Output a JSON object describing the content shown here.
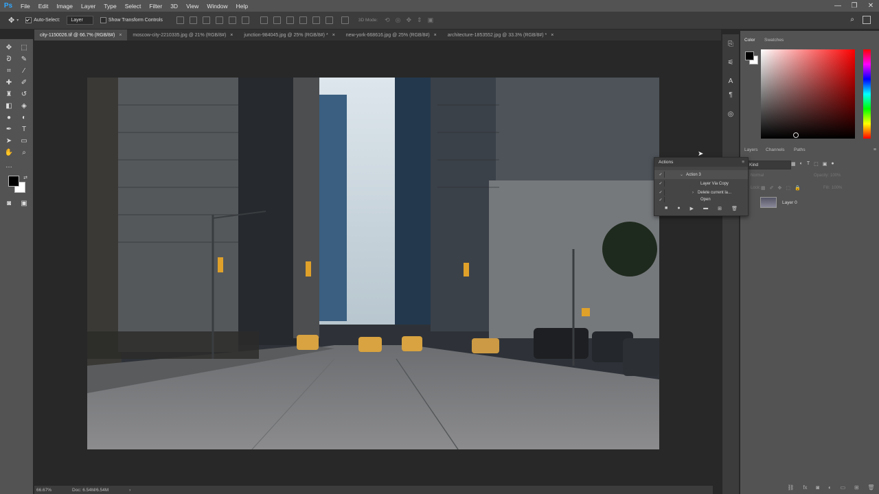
{
  "app": {
    "logo": "Ps"
  },
  "menu": [
    "File",
    "Edit",
    "Image",
    "Layer",
    "Type",
    "Select",
    "Filter",
    "3D",
    "View",
    "Window",
    "Help"
  ],
  "options": {
    "auto_select_label": "Auto-Select:",
    "auto_select_value": "Layer",
    "show_transform_label": "Show Transform Controls",
    "mode_label": "3D Mode:"
  },
  "tabs": [
    {
      "label": "city-1150026.tif @ 66.7% (RGB/8#)",
      "active": true
    },
    {
      "label": "moscow-city-2210335.jpg @ 21% (RGB/8#)",
      "active": false
    },
    {
      "label": "junction-984045.jpg @ 25% (RGB/8#) *",
      "active": false
    },
    {
      "label": "new-york-668616.jpg @ 25% (RGB/8#)",
      "active": false
    },
    {
      "label": "architecture-1853552.jpg @ 33.3% (RGB/8#) *",
      "active": false
    }
  ],
  "status": {
    "zoom": "66.67%",
    "doc": "Doc: 6.54M/6.54M"
  },
  "color_panel": {
    "tabs": [
      "Color",
      "Swatches"
    ],
    "hue_color": "#ff0000",
    "foreground": "#000000",
    "background": "#ffffff"
  },
  "layers_panel": {
    "tabs": [
      "Layers",
      "Channels",
      "Paths"
    ],
    "kind_label": "Kind",
    "mode_label": "Normal",
    "opacity_label": "Opacity:",
    "opacity_value": "100%",
    "lock_label": "Lock:",
    "fill_label": "Fill:",
    "fill_value": "100%",
    "layer_name": "Layer 0"
  },
  "actions_panel": {
    "title": "Actions",
    "rows": [
      "Action 3",
      "Layer Via Copy",
      "Delete current la...",
      "Open"
    ]
  },
  "icons": [
    "move-icon",
    "marquee-icon",
    "lasso-icon",
    "quick-select-icon",
    "crop-icon",
    "eyedropper-icon",
    "heal-icon",
    "brush-icon",
    "stamp-icon",
    "history-brush-icon",
    "eraser-icon",
    "bucket-icon",
    "blur-icon",
    "dodge-icon",
    "pen-icon",
    "type-icon",
    "path-select-icon",
    "shape-icon",
    "hand-icon",
    "zoom-icon"
  ]
}
